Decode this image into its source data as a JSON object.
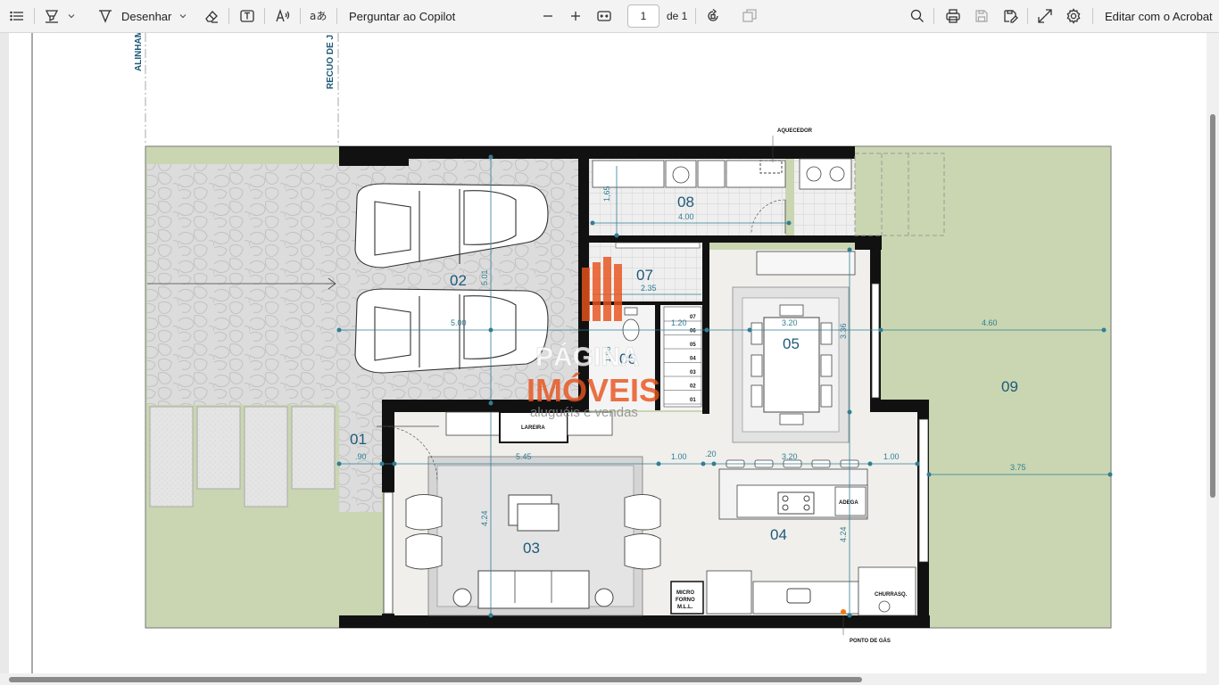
{
  "toolbar": {
    "draw_label": "Desenhar",
    "copilot_label": "Perguntar ao Copilot",
    "page_number": "1",
    "page_of": "de 1",
    "edit_acrobat_label": "Editar com o Acrobat"
  },
  "icons": [
    "contents-icon",
    "highlight-icon",
    "chevron-down-icon",
    "draw-icon",
    "eraser-icon",
    "text-box-icon",
    "read-aloud-icon",
    "translate-icon",
    "zoom-out-icon",
    "zoom-in-icon",
    "fit-page-icon",
    "rotate-icon",
    "page-view-icon",
    "search-icon",
    "print-icon",
    "save-icon",
    "save-as-icon",
    "fullscreen-icon",
    "settings-icon"
  ],
  "plan": {
    "labels": {
      "alinhamento": "ALINHAM",
      "recuo": "RECUO DE J",
      "aquecedor": "AQUECEDOR",
      "lareira": "LAREIRA",
      "adega": "ADEGA",
      "micro": "MICRO",
      "forno": "FORNO",
      "mll": "M.L.L.",
      "churrasq": "CHURRASQ.",
      "ponto_gas": "PONTO DE GÁS"
    },
    "rooms": {
      "r01": "01",
      "r02": "02",
      "r03": "03",
      "r04": "04",
      "r05": "05",
      "r06": "06",
      "r07": "07",
      "r08": "08",
      "r09": "09"
    },
    "dimensions": {
      "d_165": "1,65",
      "d_400": "4.00",
      "d_235": "2.35",
      "d_500v": "5.01",
      "d_500": "5.00",
      "d_120": "1.20",
      "d_320a": "3.20",
      "d_336": "3.36",
      "d_460": "4.60",
      "d_196": "1.96",
      "d_90": ".90",
      "d_545": "5.45",
      "d_100a": "1.00",
      "d_20": ".20",
      "d_320b": "3.20",
      "d_100b": "1.00",
      "d_375": "3.75",
      "d_424a": "4.24",
      "d_424b": "4.24"
    },
    "stairs": [
      "07",
      "06",
      "05",
      "04",
      "03",
      "02",
      "01"
    ],
    "watermark": {
      "line1": "PÁGINA",
      "line2": "IMÓVEIS",
      "line3": "aluguéis e vendas"
    }
  },
  "colors": {
    "toolbar_bg": "#f3f3f3",
    "wall": "#111111",
    "lawn": "#c9d6b1",
    "paving": "#d9d9d9",
    "floor": "#efeeea",
    "dimension": "#2f7e95",
    "watermark_orange": "#e8541e"
  }
}
